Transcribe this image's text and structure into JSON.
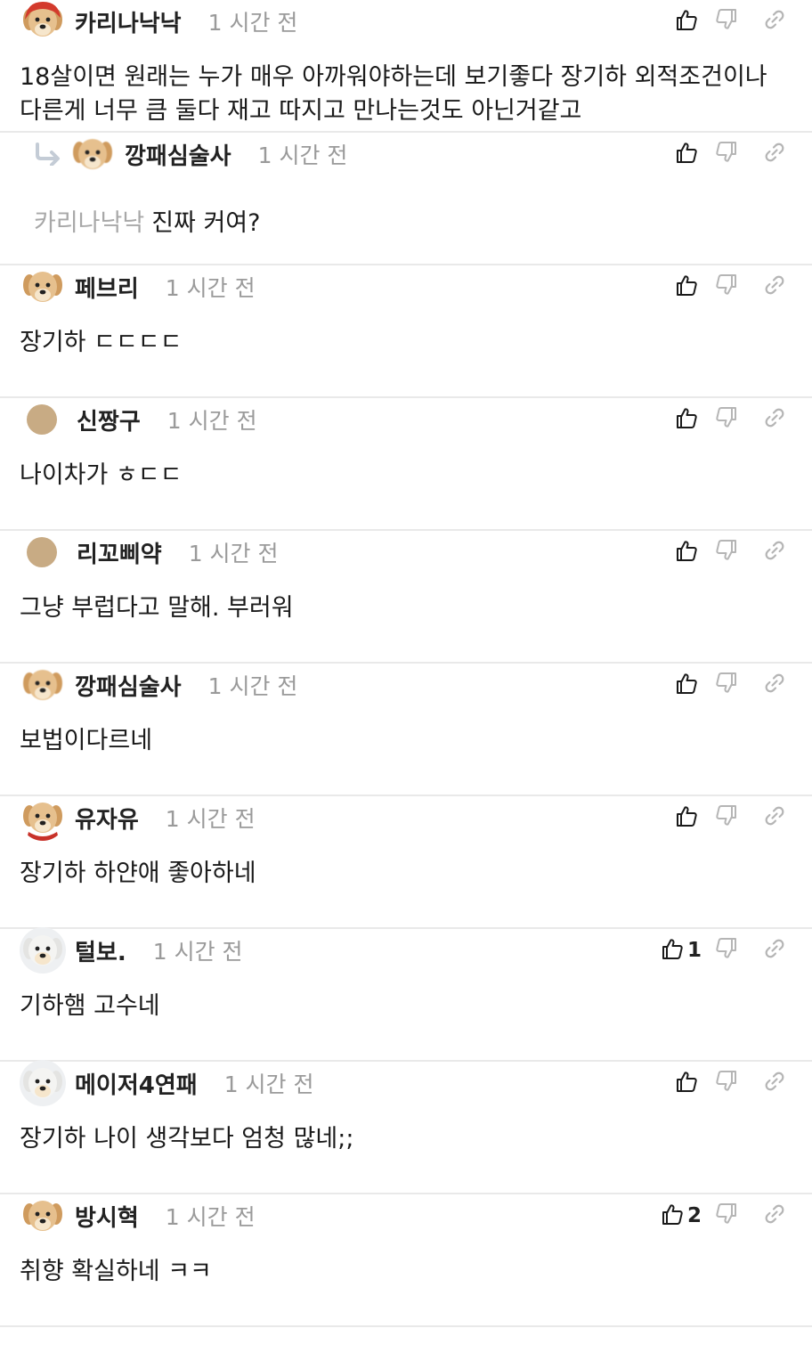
{
  "comments": [
    {
      "username": "카리나낙낙",
      "time": "1 시간 전",
      "text": "18살이면 원래는 누가 매우 아까워야하는데 보기좋다 장기하 외적조건이나 다른게 너무 큼 둘다 재고 따지고 만나는것도 아닌거같고",
      "likes": "",
      "avatar": "dog-red-hood"
    },
    {
      "username": "깡패심술사",
      "time": "1 시간 전",
      "mention": "카리나낙낙",
      "text": "진짜 커여?",
      "likes": "",
      "avatar": "dog-blurry",
      "reply": true
    },
    {
      "username": "페브리",
      "time": "1 시간 전",
      "text": "장기하 ㄷㄷㄷㄷ",
      "likes": "",
      "avatar": "dog"
    },
    {
      "username": "신짱구",
      "time": "1 시간 전",
      "text": "나이차가 ㅎㄷㄷ",
      "likes": "",
      "avatar": "plain"
    },
    {
      "username": "리꼬삐약",
      "time": "1 시간 전",
      "text": "그냥 부럽다고 말해. 부러워",
      "likes": "",
      "avatar": "plain"
    },
    {
      "username": "깡패심술사",
      "time": "1 시간 전",
      "text": "보법이다르네",
      "likes": "",
      "avatar": "dog-blurry"
    },
    {
      "username": "유자유",
      "time": "1 시간 전",
      "text": "장기하 하얀애 좋아하네",
      "likes": "",
      "avatar": "dog-red-scarf"
    },
    {
      "username": "털보.",
      "time": "1 시간 전",
      "text": "기하햄 고수네",
      "likes": "1",
      "avatar": "white-dog"
    },
    {
      "username": "메이저4연패",
      "time": "1 시간 전",
      "text": "장기하 나이 생각보다 엄청 많네;;",
      "likes": "",
      "avatar": "white-dog"
    },
    {
      "username": "방시혁",
      "time": "1 시간 전",
      "text": "취향 확실하네 ㅋㅋ",
      "likes": "2",
      "avatar": "dog"
    }
  ],
  "colors": {
    "username": "#222222",
    "timestamp": "#9a9a9a",
    "mention": "#a8a8a8",
    "icon": "#1a1a1a",
    "icon_muted": "#b5b5b5",
    "divider": "#e9e9e9"
  }
}
